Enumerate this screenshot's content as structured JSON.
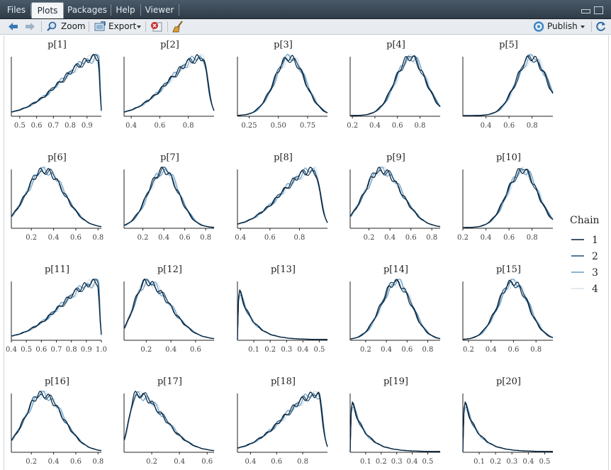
{
  "tabs": [
    {
      "label": "Files",
      "active": false
    },
    {
      "label": "Plots",
      "active": true
    },
    {
      "label": "Packages",
      "active": false
    },
    {
      "label": "Help",
      "active": false
    },
    {
      "label": "Viewer",
      "active": false
    }
  ],
  "toolbar": {
    "zoom_label": "Zoom",
    "export_label": "Export",
    "publish_label": "Publish"
  },
  "chart_data": {
    "type": "density",
    "legend": {
      "title": "Chain",
      "position": "right",
      "entries": [
        {
          "label": "1",
          "color": "#061f36"
        },
        {
          "label": "2",
          "color": "#1d4d70"
        },
        {
          "label": "3",
          "color": "#6a9ec4"
        },
        {
          "label": "4",
          "color": "#d5e3ee"
        }
      ]
    },
    "panels": [
      {
        "title": "p[1]",
        "xlim": [
          0.45,
          0.985
        ],
        "ticks": [
          0.5,
          0.6,
          0.7,
          0.8,
          0.9
        ],
        "tick_labels": [
          "0.5",
          "0.6",
          "0.7",
          "0.8",
          "0.9"
        ],
        "shape": "left_skew",
        "mode": 0.97
      },
      {
        "title": "p[2]",
        "xlim": [
          0.35,
          0.98
        ],
        "ticks": [
          0.4,
          0.6,
          0.8
        ],
        "tick_labels": [
          "0.4",
          "0.6",
          "0.8"
        ],
        "shape": "left_skew",
        "mode": 0.9
      },
      {
        "title": "p[3]",
        "xlim": [
          0.15,
          0.92
        ],
        "ticks": [
          0.25,
          0.5,
          0.75
        ],
        "tick_labels": [
          "0.25",
          "0.50",
          "0.75"
        ],
        "shape": "normal",
        "mode": 0.6
      },
      {
        "title": "p[4]",
        "xlim": [
          0.18,
          0.98
        ],
        "ticks": [
          0.2,
          0.4,
          0.6,
          0.8
        ],
        "tick_labels": [
          "0.2",
          "0.4",
          "0.6",
          "0.8"
        ],
        "shape": "normal",
        "mode": 0.72
      },
      {
        "title": "p[5]",
        "xlim": [
          0.2,
          0.98
        ],
        "ticks": [
          0.4,
          0.6,
          0.8
        ],
        "tick_labels": [
          "0.4",
          "0.6",
          "0.8"
        ],
        "shape": "normal",
        "mode": 0.8
      },
      {
        "title": "p[6]",
        "xlim": [
          0.02,
          0.83
        ],
        "ticks": [
          0.2,
          0.4,
          0.6,
          0.8
        ],
        "tick_labels": [
          "0.2",
          "0.4",
          "0.6",
          "0.8"
        ],
        "shape": "right_skew",
        "mode": 0.32
      },
      {
        "title": "p[7]",
        "xlim": [
          0.02,
          0.88
        ],
        "ticks": [
          0.2,
          0.4,
          0.6,
          0.8
        ],
        "tick_labels": [
          "0.2",
          "0.4",
          "0.6",
          "0.8"
        ],
        "shape": "normal",
        "mode": 0.4
      },
      {
        "title": "p[8]",
        "xlim": [
          0.38,
          0.99
        ],
        "ticks": [
          0.4,
          0.6,
          0.8
        ],
        "tick_labels": [
          "0.4",
          "0.6",
          "0.8"
        ],
        "shape": "left_skew",
        "mode": 0.9
      },
      {
        "title": "p[9]",
        "xlim": [
          0.02,
          0.88
        ],
        "ticks": [
          0.2,
          0.4,
          0.6,
          0.8
        ],
        "tick_labels": [
          "0.2",
          "0.4",
          "0.6",
          "0.8"
        ],
        "shape": "right_skew",
        "mode": 0.32
      },
      {
        "title": "p[10]",
        "xlim": [
          0.2,
          0.98
        ],
        "ticks": [
          0.2,
          0.4,
          0.6,
          0.8
        ],
        "tick_labels": [
          "0.2",
          "0.4",
          "0.6",
          "0.8"
        ],
        "shape": "normal",
        "mode": 0.72
      },
      {
        "title": "p[11]",
        "xlim": [
          0.4,
          1.0
        ],
        "ticks": [
          0.4,
          0.5,
          0.6,
          0.7,
          0.8,
          0.9,
          1.0
        ],
        "tick_labels": [
          "0.4",
          "0.5",
          "0.6",
          "0.7",
          "0.8",
          "0.9",
          "1.0"
        ],
        "shape": "left_skew",
        "mode": 0.98
      },
      {
        "title": "p[12]",
        "xlim": [
          0.02,
          0.75
        ],
        "ticks": [
          0.2,
          0.4,
          0.6
        ],
        "tick_labels": [
          "0.2",
          "0.4",
          "0.6"
        ],
        "shape": "right_skew",
        "mode": 0.2
      },
      {
        "title": "p[13]",
        "xlim": [
          0.0,
          0.55
        ],
        "ticks": [
          0.1,
          0.2,
          0.3,
          0.4,
          0.5
        ],
        "tick_labels": [
          "0.1",
          "0.2",
          "0.3",
          "0.4",
          "0.5"
        ],
        "shape": "decay",
        "mode": 0.02
      },
      {
        "title": "p[14]",
        "xlim": [
          0.05,
          0.92
        ],
        "ticks": [
          0.2,
          0.4,
          0.6,
          0.8
        ],
        "tick_labels": [
          "0.2",
          "0.4",
          "0.6",
          "0.8"
        ],
        "shape": "normal",
        "mode": 0.5
      },
      {
        "title": "p[15]",
        "xlim": [
          0.15,
          0.95
        ],
        "ticks": [
          0.2,
          0.4,
          0.6,
          0.8
        ],
        "tick_labels": [
          "0.2",
          "0.4",
          "0.6",
          "0.8"
        ],
        "shape": "normal",
        "mode": 0.6
      },
      {
        "title": "p[16]",
        "xlim": [
          0.02,
          0.83
        ],
        "ticks": [
          0.2,
          0.4,
          0.6,
          0.8
        ],
        "tick_labels": [
          "0.2",
          "0.4",
          "0.6",
          "0.8"
        ],
        "shape": "right_skew",
        "mode": 0.3
      },
      {
        "title": "p[17]",
        "xlim": [
          0.0,
          0.65
        ],
        "ticks": [
          0.2,
          0.4,
          0.6
        ],
        "tick_labels": [
          "0.2",
          "0.4",
          "0.6"
        ],
        "shape": "right_skew",
        "mode": 0.09
      },
      {
        "title": "p[18]",
        "xlim": [
          0.3,
          0.99
        ],
        "ticks": [
          0.4,
          0.6,
          0.8
        ],
        "tick_labels": [
          "0.4",
          "0.6",
          "0.8"
        ],
        "shape": "left_skew",
        "mode": 0.92
      },
      {
        "title": "p[19]",
        "xlim": [
          0.0,
          0.58
        ],
        "ticks": [
          0.1,
          0.2,
          0.3,
          0.4,
          0.5
        ],
        "tick_labels": [
          "0.1",
          "0.2",
          "0.3",
          "0.4",
          "0.5"
        ],
        "shape": "decay",
        "mode": 0.02
      },
      {
        "title": "p[20]",
        "xlim": [
          0.0,
          0.55
        ],
        "ticks": [
          0.1,
          0.2,
          0.3,
          0.4,
          0.5
        ],
        "tick_labels": [
          "0.1",
          "0.2",
          "0.3",
          "0.4",
          "0.5"
        ],
        "shape": "decay",
        "mode": 0.02
      }
    ]
  }
}
